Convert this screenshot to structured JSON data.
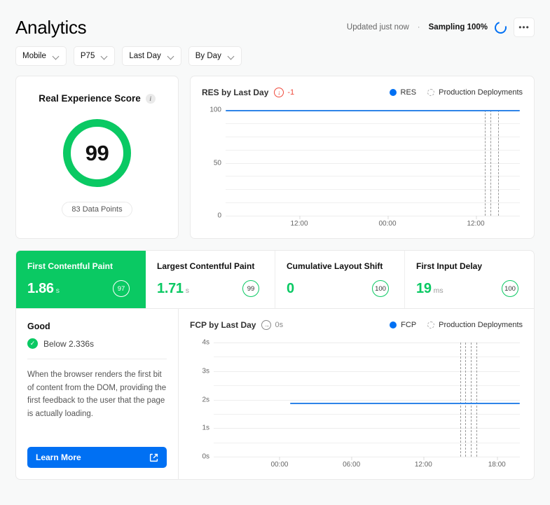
{
  "header": {
    "title": "Analytics",
    "updated": "Updated just now",
    "separator": "·",
    "sampling": "Sampling 100%",
    "more_label": "•••"
  },
  "filters": [
    {
      "label": "Mobile"
    },
    {
      "label": "P75"
    },
    {
      "label": "Last Day"
    },
    {
      "label": "By Day"
    }
  ],
  "real_experience_score": {
    "title": "Real Experience Score",
    "score": "99",
    "data_points": "83 Data Points",
    "ring_color": "#0ac963"
  },
  "metrics": [
    {
      "name": "First Contentful Paint",
      "value": "1.86",
      "unit": "s",
      "score": "97",
      "active": true
    },
    {
      "name": "Largest Contentful Paint",
      "value": "1.71",
      "unit": "s",
      "score": "99",
      "active": false
    },
    {
      "name": "Cumulative Layout Shift",
      "value": "0",
      "unit": "",
      "score": "100",
      "active": false
    },
    {
      "name": "First Input Delay",
      "value": "19",
      "unit": "ms",
      "score": "100",
      "active": false
    }
  ],
  "detail": {
    "status": "Good",
    "threshold": "Below 2.336s",
    "description": "When the browser renders the first bit of content from the DOM, providing the first feedback to the user that the page is actually loading.",
    "learn_more": "Learn More"
  },
  "chart_data": [
    {
      "id": "res",
      "type": "line",
      "title": "RES by Last Day",
      "delta": "-1",
      "delta_direction": "down",
      "delta_color": "#ef4a3c",
      "legend": [
        "RES",
        "Production Deployments"
      ],
      "ylabel": "",
      "xlabel": "",
      "ylim": [
        0,
        100
      ],
      "yticks": [
        0,
        50,
        100
      ],
      "ytick_labels": [
        "0",
        "50",
        "100"
      ],
      "gridlines": [
        0,
        12.5,
        25,
        37.5,
        50,
        62.5,
        75,
        87.5,
        100
      ],
      "xticks": [
        0.25,
        0.55,
        0.85
      ],
      "xtick_labels": [
        "12:00",
        "00:00",
        "12:00"
      ],
      "series": [
        {
          "name": "RES",
          "color": "#2f84e8",
          "x_start": 0.0,
          "x_end": 1.0,
          "value": 99.6
        }
      ],
      "deployments": [
        0.88,
        0.9,
        0.925
      ],
      "legend_position": "top-right",
      "grid": true
    },
    {
      "id": "fcp",
      "type": "line",
      "title": "FCP by Last Day",
      "delta": "0s",
      "delta_direction": "flat",
      "delta_color": "#8a8a8a",
      "legend": [
        "FCP",
        "Production Deployments"
      ],
      "ylabel": "",
      "xlabel": "",
      "ylim": [
        0,
        4
      ],
      "yticks": [
        0,
        1,
        2,
        3,
        4
      ],
      "ytick_labels": [
        "0s",
        "1s",
        "2s",
        "3s",
        "4s"
      ],
      "gridlines": [
        0,
        0.5,
        1,
        1.5,
        2,
        2.5,
        3,
        3.5,
        4
      ],
      "xticks": [
        0.215,
        0.45,
        0.685,
        0.925
      ],
      "xtick_labels": [
        "00:00",
        "06:00",
        "12:00",
        "18:00"
      ],
      "series": [
        {
          "name": "FCP",
          "color": "#2f84e8",
          "x_start": 0.25,
          "x_end": 1.0,
          "value": 1.86
        }
      ],
      "deployments": [
        0.805,
        0.822,
        0.84,
        0.858
      ],
      "legend_position": "top-right",
      "grid": true
    }
  ]
}
